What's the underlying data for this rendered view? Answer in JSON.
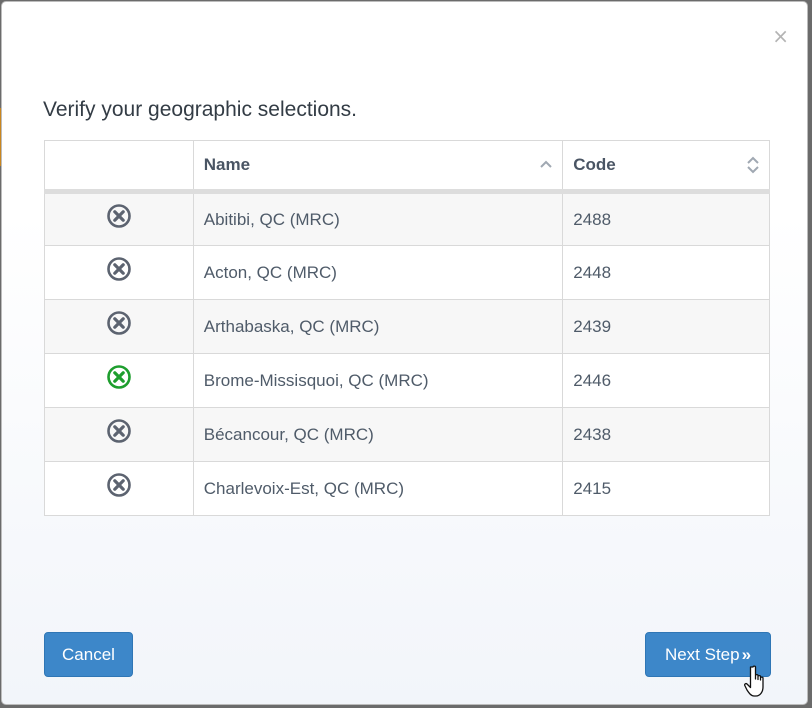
{
  "modal": {
    "close_glyph": "×",
    "title": "Verify your geographic selections.",
    "table": {
      "headers": {
        "icon": "",
        "name": "Name",
        "code": "Code"
      },
      "rows": [
        {
          "name": "Abitibi, QC (MRC)",
          "code": "2488",
          "icon": "remove-circle-icon",
          "highlight": false
        },
        {
          "name": "Acton, QC (MRC)",
          "code": "2448",
          "icon": "remove-circle-icon",
          "highlight": false
        },
        {
          "name": "Arthabaska, QC (MRC)",
          "code": "2439",
          "icon": "remove-circle-icon",
          "highlight": false
        },
        {
          "name": "Brome-Missisquoi, QC (MRC)",
          "code": "2446",
          "icon": "remove-circle-icon",
          "highlight": true
        },
        {
          "name": "Bécancour, QC (MRC)",
          "code": "2438",
          "icon": "remove-circle-icon",
          "highlight": false
        },
        {
          "name": "Charlevoix-Est, QC (MRC)",
          "code": "2415",
          "icon": "remove-circle-icon",
          "highlight": false
        }
      ]
    },
    "buttons": {
      "cancel": "Cancel",
      "next": "Next Step",
      "next_glyph": "»"
    }
  },
  "colors": {
    "primary": "#3d87c9",
    "icon_default": "#5c6370",
    "icon_hover": "#1e9e2e"
  }
}
